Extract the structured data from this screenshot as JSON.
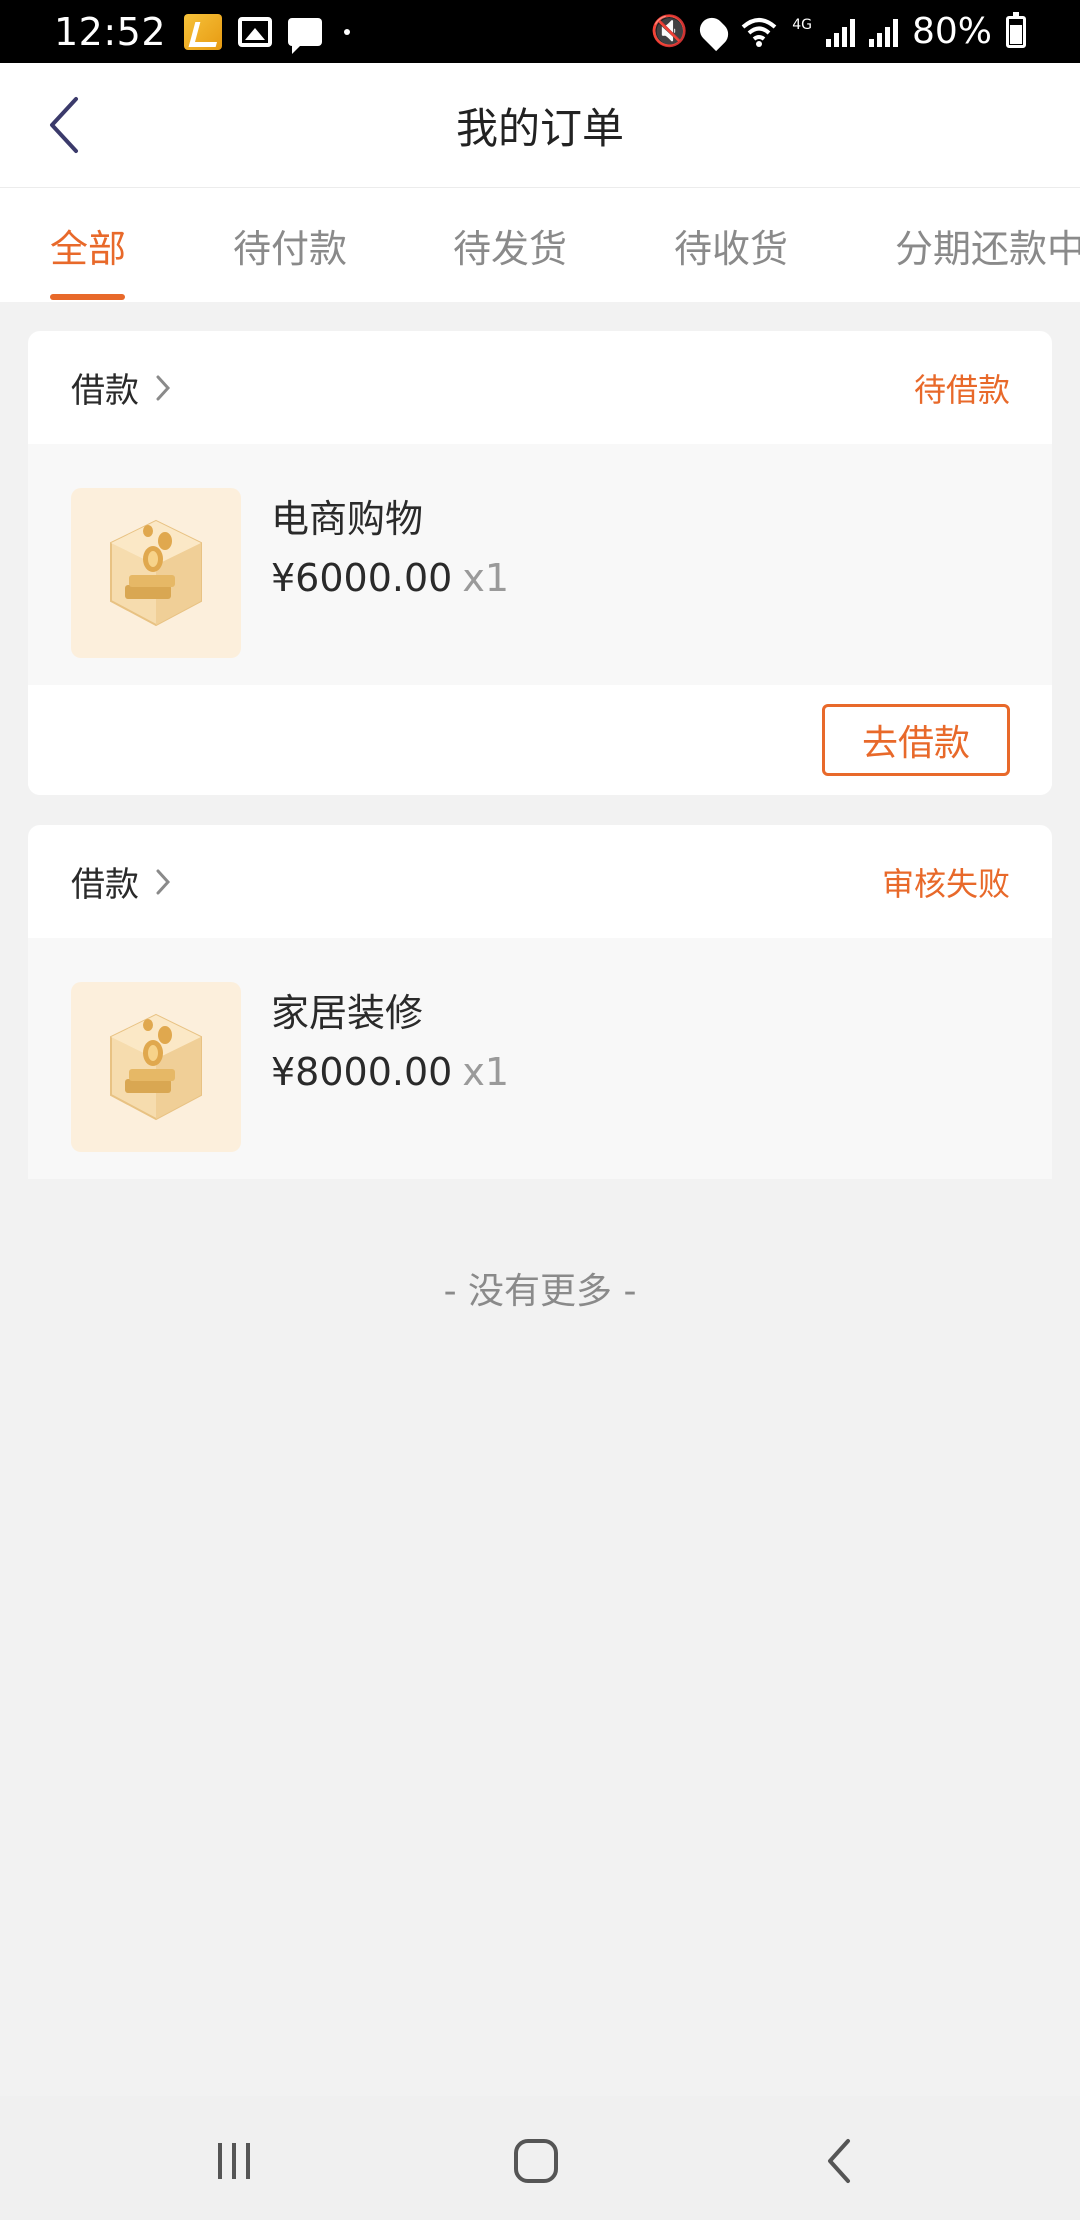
{
  "status_bar": {
    "time": "12:52",
    "battery": "80%",
    "network": "4G"
  },
  "header": {
    "title": "我的订单"
  },
  "tabs": [
    {
      "label": "全部",
      "active": true
    },
    {
      "label": "待付款",
      "active": false
    },
    {
      "label": "待发货",
      "active": false
    },
    {
      "label": "待收货",
      "active": false
    },
    {
      "label": "分期还款中",
      "active": false
    }
  ],
  "orders": [
    {
      "type": "借款",
      "status": "待借款",
      "item_name": "电商购物",
      "price": "¥6000.00",
      "qty": "x1",
      "action": "去借款"
    },
    {
      "type": "借款",
      "status": "审核失败",
      "item_name": "家居装修",
      "price": "¥8000.00",
      "qty": "x1"
    }
  ],
  "footer_text": "- 没有更多 -",
  "colors": {
    "accent": "#e8692a",
    "background": "#f2f2f2"
  },
  "icons": {
    "back": "chevron-left-icon",
    "forward": "chevron-right-icon",
    "thumb": "coin-box-icon",
    "sys_recent": "recent-apps-icon",
    "sys_home": "home-icon",
    "sys_back": "back-icon"
  }
}
